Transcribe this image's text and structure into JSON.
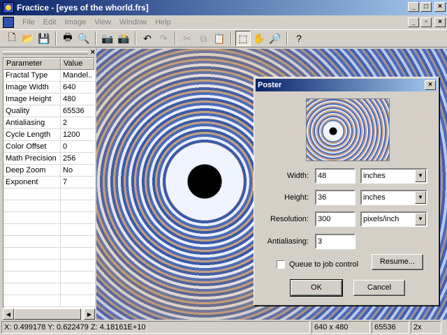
{
  "window": {
    "title": "Fractice - [eyes of the whorld.frs]"
  },
  "menu": [
    "File",
    "Edit",
    "Image",
    "View",
    "Window",
    "Help"
  ],
  "toolbar": {
    "icons": [
      "new-icon",
      "open-icon",
      "save-icon",
      "print-icon",
      "print-preview-icon",
      "snapshot-icon",
      "multi-snapshot-icon",
      "undo-icon",
      "redo-icon",
      "cut-icon",
      "copy-icon",
      "paste-icon",
      "select-icon",
      "pan-hand-icon",
      "zoom-icon",
      "help-icon"
    ]
  },
  "panel": {
    "headers": {
      "parameter": "Parameter",
      "value": "Value"
    },
    "rows": [
      {
        "param": "Fractal Type",
        "value": "Mandel.."
      },
      {
        "param": "Image Width",
        "value": "640"
      },
      {
        "param": "Image Height",
        "value": "480"
      },
      {
        "param": "Quality",
        "value": "65536"
      },
      {
        "param": "Antialiasing",
        "value": "2"
      },
      {
        "param": "Cycle Length",
        "value": "1200"
      },
      {
        "param": "Color Offset",
        "value": "0"
      },
      {
        "param": "Math Precision",
        "value": "256"
      },
      {
        "param": "Deep Zoom",
        "value": "No"
      },
      {
        "param": "Exponent",
        "value": "7"
      }
    ]
  },
  "dialog": {
    "title": "Poster",
    "close": "×",
    "width_label": "Width:",
    "width_value": "48",
    "width_unit": "inches",
    "height_label": "Height:",
    "height_value": "36",
    "height_unit": "inches",
    "resolution_label": "Resolution:",
    "resolution_value": "300",
    "resolution_unit": "pixels/inch",
    "antialiasing_label": "Antialiasing:",
    "antialiasing_value": "3",
    "queue_label": "Queue to job control",
    "resume_label": "Resume...",
    "ok_label": "OK",
    "cancel_label": "Cancel"
  },
  "status": {
    "coords": "X: 0.499178  Y: 0.622479  Z: 4.18161E+10",
    "size": "640 x 480",
    "quality": "65536",
    "zoom": "2x"
  }
}
